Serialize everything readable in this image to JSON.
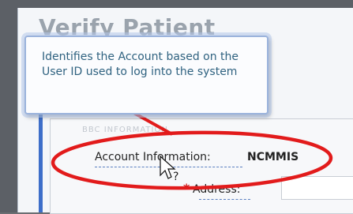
{
  "window": {
    "title": "Verify Patient"
  },
  "faded_label": "BBC  INFORMATION",
  "form": {
    "account_label": "Account Information:",
    "account_value": "NCMMIS",
    "address_label": "Address:",
    "required_marker": "*",
    "address_value": ""
  },
  "tooltip": {
    "text": "Identifies the Account based on the User ID used to log into the system"
  },
  "colors": {
    "annotation_red": "#e21b1b",
    "tooltip_text": "#2f6280",
    "accent_blue": "#3d6ec9"
  },
  "icons": {
    "cursor": "mouse-pointer-icon",
    "help": "help-cursor-icon"
  }
}
